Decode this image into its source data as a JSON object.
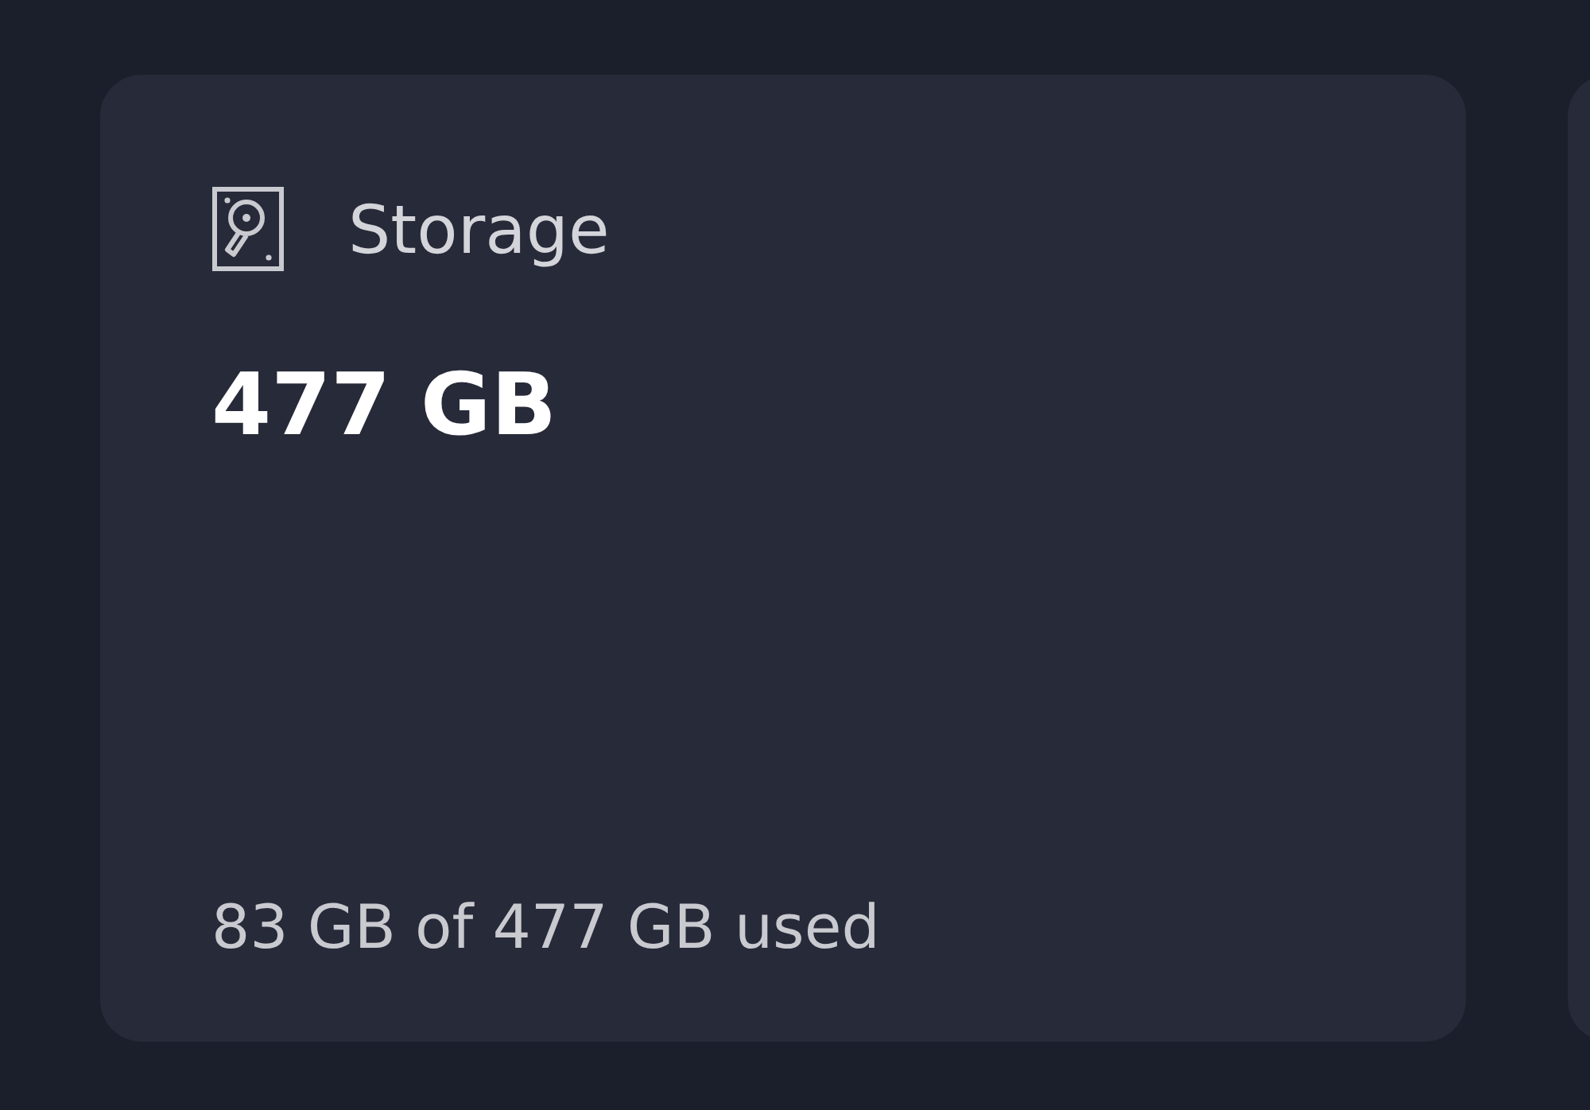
{
  "storage_card": {
    "title": "Storage",
    "total": "477 GB",
    "usage": "83 GB of 477 GB used"
  }
}
